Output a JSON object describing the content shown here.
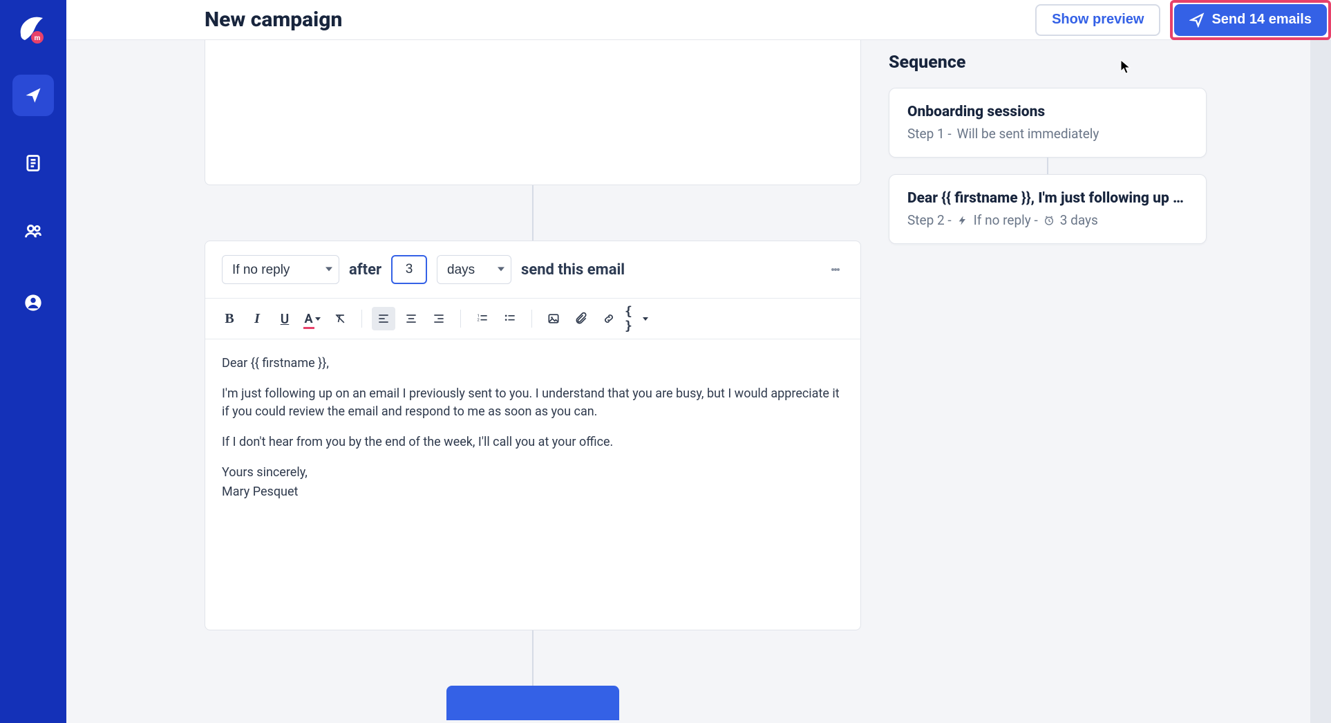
{
  "page_title": "New campaign",
  "header": {
    "preview_label": "Show preview",
    "send_label": "Send 14 emails"
  },
  "condition": {
    "trigger": "If no reply",
    "after_label": "after",
    "delay_value": "3",
    "unit": "days",
    "action_label": "send this email"
  },
  "body": {
    "p1": "Dear {{ firstname }},",
    "p2": "I'm just following up on an email I previously sent to you. I understand that you are busy, but I would appreciate it if you could review the email and respond to me as soon as you can.",
    "p3": "If I don't hear from you by the end of the week, I'll call you at your office.",
    "p4": "Yours sincerely,",
    "p5": "Mary Pesquet"
  },
  "sequence": {
    "heading": "Sequence",
    "steps": [
      {
        "title": "Onboarding sessions",
        "sub_prefix": "Step 1 - ",
        "sub_text": "Will be sent immediately"
      },
      {
        "title": "Dear {{ firstname }}, I'm just following up …",
        "sub_prefix": "Step 2 - ",
        "sub_cond": "If no reply - ",
        "sub_time": "3 days"
      }
    ]
  },
  "colors": {
    "primary": "#3461e6",
    "nav_bg": "#1431b8",
    "highlight": "#e7416a"
  }
}
